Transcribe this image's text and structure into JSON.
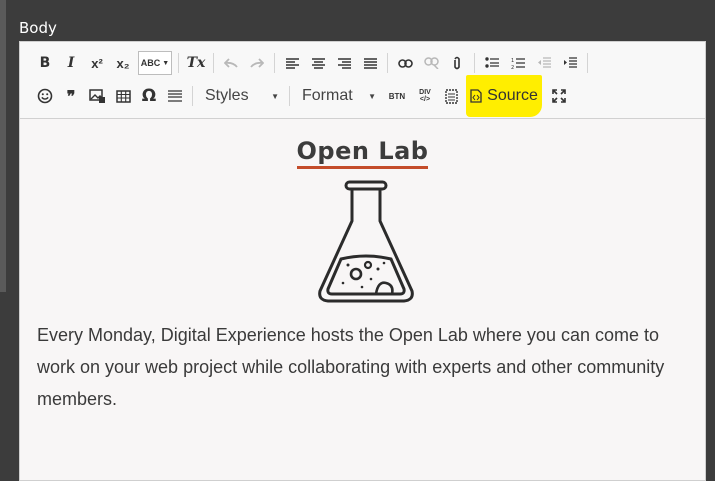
{
  "field": {
    "label": "Body"
  },
  "toolbar": {
    "row1": {
      "bold": "B",
      "italic": "I",
      "superscript": "x²",
      "subscript": "x₂",
      "spellcheck": "ABC",
      "remove_format": "Tx"
    },
    "row2": {
      "blockquote": "99",
      "styles_label": "Styles",
      "format_label": "Format",
      "button_label": "BTN",
      "div_label": "DIV",
      "source_label": "Source"
    },
    "highlight_color": "#ffee00"
  },
  "content": {
    "heading": "Open Lab",
    "heading_underline_color": "#c44c2a",
    "paragraph": "Every Monday, Digital Experience hosts the Open Lab where you can come to work on your web project while collaborating with experts and other community members."
  }
}
